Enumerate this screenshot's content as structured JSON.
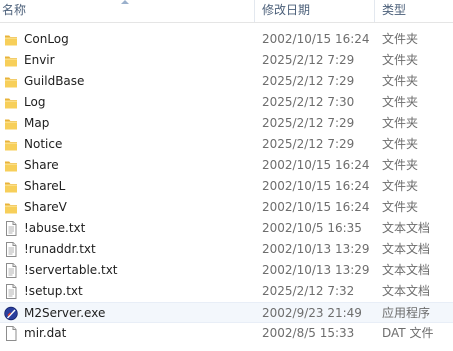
{
  "columns": {
    "name": "名称",
    "date": "修改日期",
    "type": "类型"
  },
  "files": [
    {
      "name": "ConLog",
      "date": "2002/10/15 16:24",
      "type": "文件夹",
      "icon": "folder-icon"
    },
    {
      "name": "Envir",
      "date": "2025/2/12 7:29",
      "type": "文件夹",
      "icon": "folder-icon"
    },
    {
      "name": "GuildBase",
      "date": "2025/2/12 7:29",
      "type": "文件夹",
      "icon": "folder-icon"
    },
    {
      "name": "Log",
      "date": "2025/2/12 7:30",
      "type": "文件夹",
      "icon": "folder-icon"
    },
    {
      "name": "Map",
      "date": "2025/2/12 7:29",
      "type": "文件夹",
      "icon": "folder-icon"
    },
    {
      "name": "Notice",
      "date": "2025/2/12 7:29",
      "type": "文件夹",
      "icon": "folder-icon"
    },
    {
      "name": "Share",
      "date": "2002/10/15 16:24",
      "type": "文件夹",
      "icon": "folder-icon"
    },
    {
      "name": "ShareL",
      "date": "2002/10/15 16:24",
      "type": "文件夹",
      "icon": "folder-icon"
    },
    {
      "name": "ShareV",
      "date": "2002/10/15 16:24",
      "type": "文件夹",
      "icon": "folder-icon"
    },
    {
      "name": "!abuse.txt",
      "date": "2002/10/5 16:35",
      "type": "文本文档",
      "icon": "text-document-icon"
    },
    {
      "name": "!runaddr.txt",
      "date": "2002/10/13 13:29",
      "type": "文本文档",
      "icon": "text-document-icon"
    },
    {
      "name": "!servertable.txt",
      "date": "2002/10/13 13:29",
      "type": "文本文档",
      "icon": "text-document-icon"
    },
    {
      "name": "!setup.txt",
      "date": "2025/2/12 7:32",
      "type": "文本文档",
      "icon": "text-document-icon"
    },
    {
      "name": "M2Server.exe",
      "date": "2002/9/23 21:49",
      "type": "应用程序",
      "icon": "application-icon",
      "selected": true
    },
    {
      "name": "mir.dat",
      "date": "2002/8/5 15:33",
      "type": "DAT 文件",
      "icon": "blank-file-icon"
    }
  ],
  "colors": {
    "header_text": "#4c607a",
    "folder": "#f5c84c",
    "selected_row": "#f3f7fc"
  }
}
